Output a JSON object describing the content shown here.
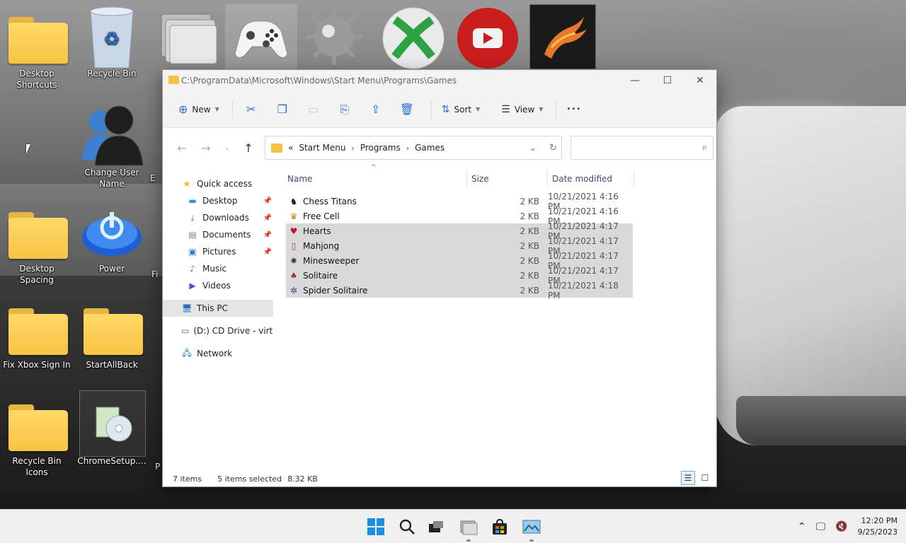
{
  "desktop": {
    "icons": [
      {
        "label": "Desktop Shortcuts"
      },
      {
        "label": "Recycle Bin"
      },
      {
        "label": "Change User Name"
      },
      {
        "label": "Desktop Spacing"
      },
      {
        "label": "Power"
      },
      {
        "label": "Fix Xbox Sign In"
      },
      {
        "label": "StartAllBack"
      },
      {
        "label": "Recycle Bin Icons"
      },
      {
        "label": "ChromeSetup...."
      }
    ],
    "partial_labels": [
      "E",
      "Fi",
      "P"
    ]
  },
  "window": {
    "title_path": "C:\\ProgramData\\Microsoft\\Windows\\Start Menu\\Programs\\Games",
    "controls": {
      "minimize": "—",
      "maximize": "☐",
      "close": "✕"
    },
    "toolbar": {
      "new_label": "New",
      "sort_label": "Sort",
      "view_label": "View",
      "more_label": "•••"
    },
    "address": {
      "overflow": "«",
      "crumbs": [
        "Start Menu",
        "Programs",
        "Games"
      ],
      "search_placeholder": ""
    },
    "nav": {
      "quick_access": "Quick access",
      "items": [
        {
          "label": "Desktop",
          "icon": "desktop-icon"
        },
        {
          "label": "Downloads",
          "icon": "download-icon"
        },
        {
          "label": "Documents",
          "icon": "document-icon"
        },
        {
          "label": "Pictures",
          "icon": "pictures-icon"
        },
        {
          "label": "Music",
          "icon": "music-icon"
        },
        {
          "label": "Videos",
          "icon": "videos-icon"
        }
      ],
      "this_pc": "This PC",
      "cd_drive": "(D:) CD Drive - virti",
      "network": "Network"
    },
    "columns": {
      "name": "Name",
      "size": "Size",
      "date": "Date modified"
    },
    "files": [
      {
        "name": "Chess Titans",
        "size": "2 KB",
        "date": "10/21/2021 4:16 PM",
        "selected": false
      },
      {
        "name": "Free Cell",
        "size": "2 KB",
        "date": "10/21/2021 4:16 PM",
        "selected": false
      },
      {
        "name": "Hearts",
        "size": "2 KB",
        "date": "10/21/2021 4:17 PM",
        "selected": true
      },
      {
        "name": "Mahjong",
        "size": "2 KB",
        "date": "10/21/2021 4:17 PM",
        "selected": true
      },
      {
        "name": "Minesweeper",
        "size": "2 KB",
        "date": "10/21/2021 4:17 PM",
        "selected": true
      },
      {
        "name": "Solitaire",
        "size": "2 KB",
        "date": "10/21/2021 4:17 PM",
        "selected": true
      },
      {
        "name": "Spider Solitaire",
        "size": "2 KB",
        "date": "10/21/2021 4:18 PM",
        "selected": true
      }
    ],
    "status": {
      "count": "7 items",
      "selected": "5 items selected",
      "size": "8.32 KB"
    }
  },
  "taskbar": {
    "time": "12:20 PM",
    "date": "9/25/2023"
  }
}
